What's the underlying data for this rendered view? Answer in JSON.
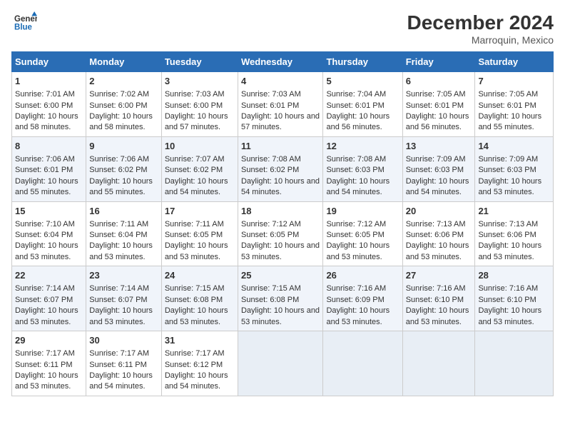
{
  "header": {
    "logo_line1": "General",
    "logo_line2": "Blue",
    "title": "December 2024",
    "subtitle": "Marroquin, Mexico"
  },
  "columns": [
    "Sunday",
    "Monday",
    "Tuesday",
    "Wednesday",
    "Thursday",
    "Friday",
    "Saturday"
  ],
  "weeks": [
    [
      {
        "day": "1",
        "sunrise": "Sunrise: 7:01 AM",
        "sunset": "Sunset: 6:00 PM",
        "daylight": "Daylight: 10 hours and 58 minutes."
      },
      {
        "day": "2",
        "sunrise": "Sunrise: 7:02 AM",
        "sunset": "Sunset: 6:00 PM",
        "daylight": "Daylight: 10 hours and 58 minutes."
      },
      {
        "day": "3",
        "sunrise": "Sunrise: 7:03 AM",
        "sunset": "Sunset: 6:00 PM",
        "daylight": "Daylight: 10 hours and 57 minutes."
      },
      {
        "day": "4",
        "sunrise": "Sunrise: 7:03 AM",
        "sunset": "Sunset: 6:01 PM",
        "daylight": "Daylight: 10 hours and 57 minutes."
      },
      {
        "day": "5",
        "sunrise": "Sunrise: 7:04 AM",
        "sunset": "Sunset: 6:01 PM",
        "daylight": "Daylight: 10 hours and 56 minutes."
      },
      {
        "day": "6",
        "sunrise": "Sunrise: 7:05 AM",
        "sunset": "Sunset: 6:01 PM",
        "daylight": "Daylight: 10 hours and 56 minutes."
      },
      {
        "day": "7",
        "sunrise": "Sunrise: 7:05 AM",
        "sunset": "Sunset: 6:01 PM",
        "daylight": "Daylight: 10 hours and 55 minutes."
      }
    ],
    [
      {
        "day": "8",
        "sunrise": "Sunrise: 7:06 AM",
        "sunset": "Sunset: 6:01 PM",
        "daylight": "Daylight: 10 hours and 55 minutes."
      },
      {
        "day": "9",
        "sunrise": "Sunrise: 7:06 AM",
        "sunset": "Sunset: 6:02 PM",
        "daylight": "Daylight: 10 hours and 55 minutes."
      },
      {
        "day": "10",
        "sunrise": "Sunrise: 7:07 AM",
        "sunset": "Sunset: 6:02 PM",
        "daylight": "Daylight: 10 hours and 54 minutes."
      },
      {
        "day": "11",
        "sunrise": "Sunrise: 7:08 AM",
        "sunset": "Sunset: 6:02 PM",
        "daylight": "Daylight: 10 hours and 54 minutes."
      },
      {
        "day": "12",
        "sunrise": "Sunrise: 7:08 AM",
        "sunset": "Sunset: 6:03 PM",
        "daylight": "Daylight: 10 hours and 54 minutes."
      },
      {
        "day": "13",
        "sunrise": "Sunrise: 7:09 AM",
        "sunset": "Sunset: 6:03 PM",
        "daylight": "Daylight: 10 hours and 54 minutes."
      },
      {
        "day": "14",
        "sunrise": "Sunrise: 7:09 AM",
        "sunset": "Sunset: 6:03 PM",
        "daylight": "Daylight: 10 hours and 53 minutes."
      }
    ],
    [
      {
        "day": "15",
        "sunrise": "Sunrise: 7:10 AM",
        "sunset": "Sunset: 6:04 PM",
        "daylight": "Daylight: 10 hours and 53 minutes."
      },
      {
        "day": "16",
        "sunrise": "Sunrise: 7:11 AM",
        "sunset": "Sunset: 6:04 PM",
        "daylight": "Daylight: 10 hours and 53 minutes."
      },
      {
        "day": "17",
        "sunrise": "Sunrise: 7:11 AM",
        "sunset": "Sunset: 6:05 PM",
        "daylight": "Daylight: 10 hours and 53 minutes."
      },
      {
        "day": "18",
        "sunrise": "Sunrise: 7:12 AM",
        "sunset": "Sunset: 6:05 PM",
        "daylight": "Daylight: 10 hours and 53 minutes."
      },
      {
        "day": "19",
        "sunrise": "Sunrise: 7:12 AM",
        "sunset": "Sunset: 6:05 PM",
        "daylight": "Daylight: 10 hours and 53 minutes."
      },
      {
        "day": "20",
        "sunrise": "Sunrise: 7:13 AM",
        "sunset": "Sunset: 6:06 PM",
        "daylight": "Daylight: 10 hours and 53 minutes."
      },
      {
        "day": "21",
        "sunrise": "Sunrise: 7:13 AM",
        "sunset": "Sunset: 6:06 PM",
        "daylight": "Daylight: 10 hours and 53 minutes."
      }
    ],
    [
      {
        "day": "22",
        "sunrise": "Sunrise: 7:14 AM",
        "sunset": "Sunset: 6:07 PM",
        "daylight": "Daylight: 10 hours and 53 minutes."
      },
      {
        "day": "23",
        "sunrise": "Sunrise: 7:14 AM",
        "sunset": "Sunset: 6:07 PM",
        "daylight": "Daylight: 10 hours and 53 minutes."
      },
      {
        "day": "24",
        "sunrise": "Sunrise: 7:15 AM",
        "sunset": "Sunset: 6:08 PM",
        "daylight": "Daylight: 10 hours and 53 minutes."
      },
      {
        "day": "25",
        "sunrise": "Sunrise: 7:15 AM",
        "sunset": "Sunset: 6:08 PM",
        "daylight": "Daylight: 10 hours and 53 minutes."
      },
      {
        "day": "26",
        "sunrise": "Sunrise: 7:16 AM",
        "sunset": "Sunset: 6:09 PM",
        "daylight": "Daylight: 10 hours and 53 minutes."
      },
      {
        "day": "27",
        "sunrise": "Sunrise: 7:16 AM",
        "sunset": "Sunset: 6:10 PM",
        "daylight": "Daylight: 10 hours and 53 minutes."
      },
      {
        "day": "28",
        "sunrise": "Sunrise: 7:16 AM",
        "sunset": "Sunset: 6:10 PM",
        "daylight": "Daylight: 10 hours and 53 minutes."
      }
    ],
    [
      {
        "day": "29",
        "sunrise": "Sunrise: 7:17 AM",
        "sunset": "Sunset: 6:11 PM",
        "daylight": "Daylight: 10 hours and 53 minutes."
      },
      {
        "day": "30",
        "sunrise": "Sunrise: 7:17 AM",
        "sunset": "Sunset: 6:11 PM",
        "daylight": "Daylight: 10 hours and 54 minutes."
      },
      {
        "day": "31",
        "sunrise": "Sunrise: 7:17 AM",
        "sunset": "Sunset: 6:12 PM",
        "daylight": "Daylight: 10 hours and 54 minutes."
      },
      null,
      null,
      null,
      null
    ]
  ]
}
